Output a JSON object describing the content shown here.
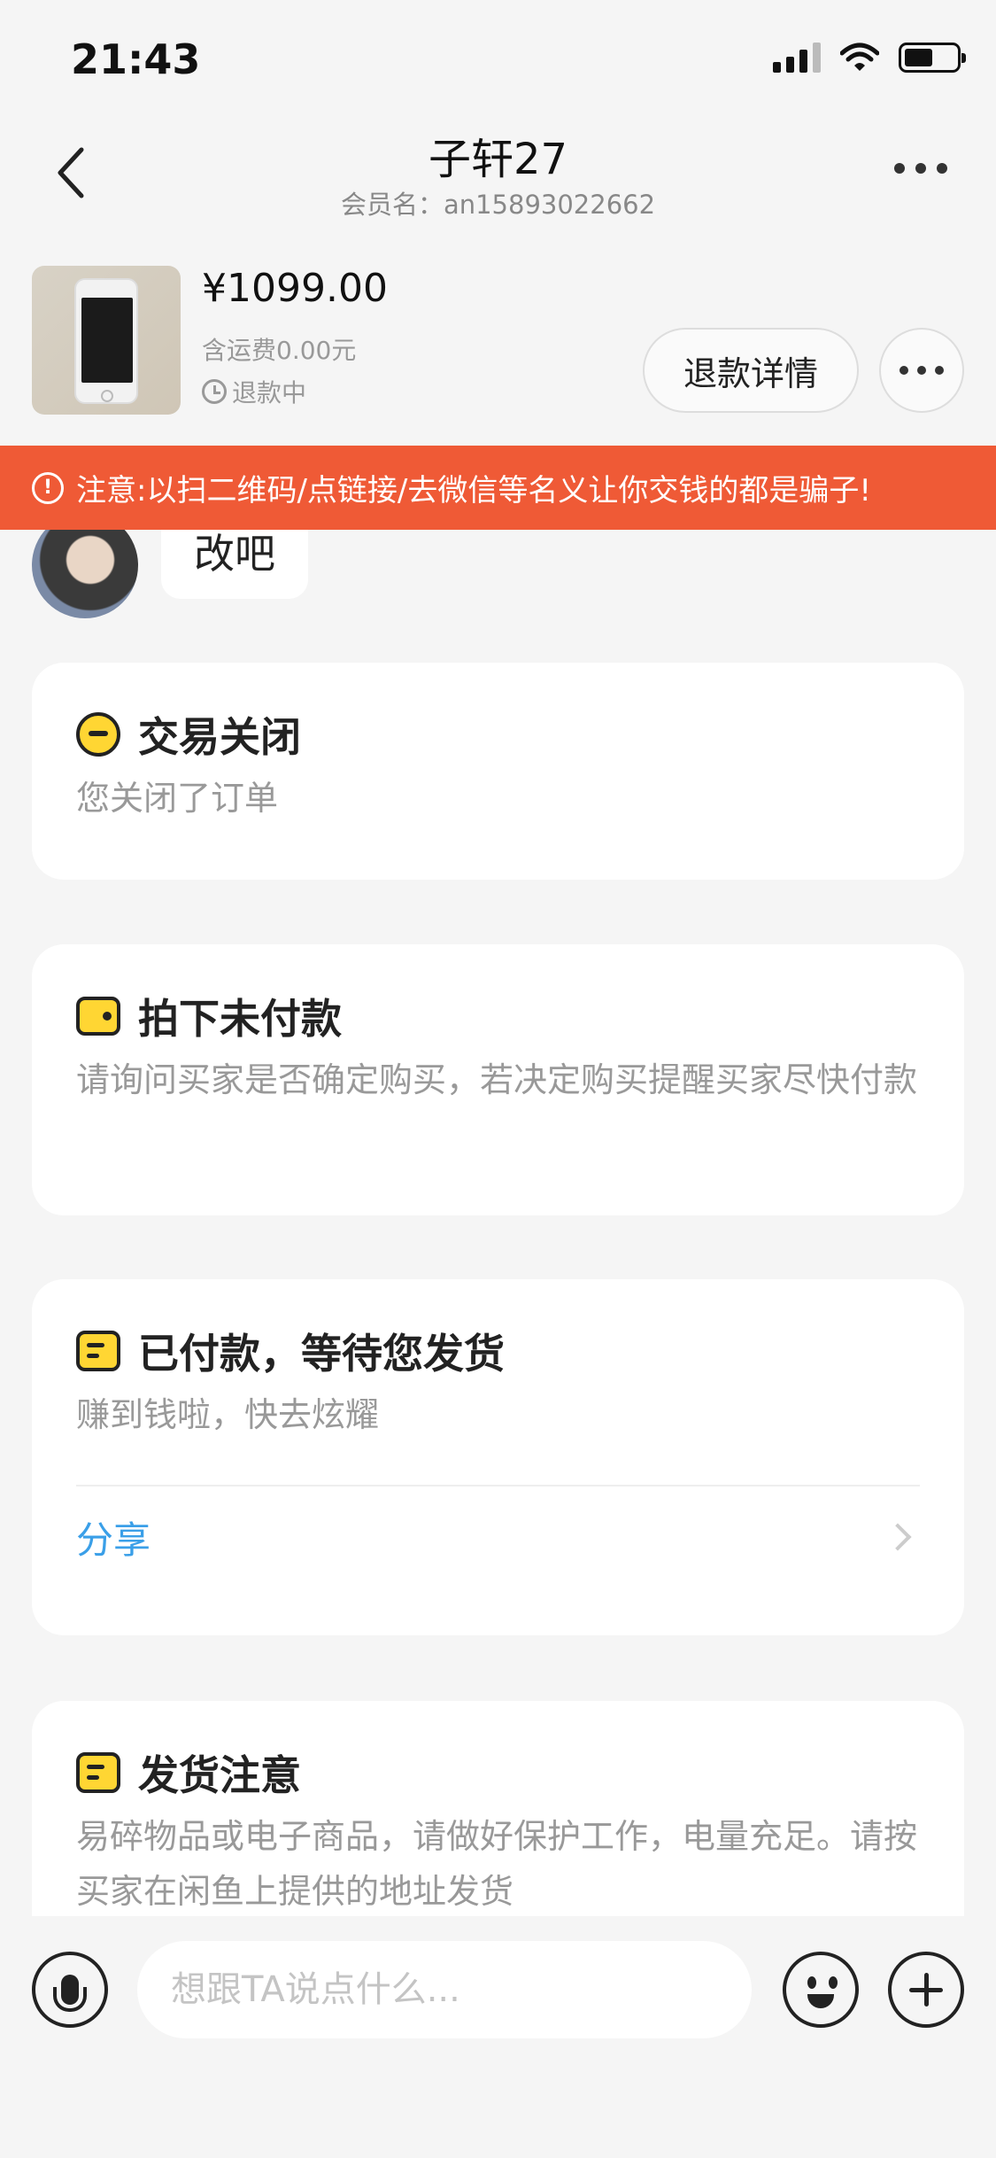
{
  "status_bar": {
    "time": "21:43",
    "icons": [
      "signal-icon",
      "wifi-icon",
      "battery-icon"
    ]
  },
  "header": {
    "title": "子轩27",
    "subtitle": "会员名：an15893022662",
    "back_icon": "chevron-left-icon",
    "more_icon": "more-icon"
  },
  "product": {
    "price": "¥1099.00",
    "shipping": "含运费0.00元",
    "status": "退款中",
    "refund_button": "退款详情"
  },
  "warning": {
    "text": "注意:以扫二维码/点链接/去微信等名义让你交钱的都是骗子!",
    "color": "#ef5a36"
  },
  "chat": {
    "partial_message": "改吧",
    "cards": [
      {
        "title": "交易关闭",
        "desc": "您关闭了订单"
      },
      {
        "title": "拍下未付款",
        "desc": "请询问买家是否确定购买，若决定购买提醒买家尽快付款"
      },
      {
        "title": "已付款，等待您发货",
        "desc": "赚到钱啦，快去炫耀",
        "action": "分享"
      },
      {
        "title": "发货注意",
        "desc": "易碎物品或电子商品，请做好保护工作，电量充足。请按买家在闲鱼上提供的地址发货"
      }
    ]
  },
  "input_bar": {
    "placeholder": "想跟TA说点什么...",
    "icons": [
      "mic-icon",
      "emoji-icon",
      "plus-icon"
    ]
  },
  "colors": {
    "accent": "#ffd633",
    "link": "#3a9fe8",
    "background": "#f5f5f5"
  }
}
